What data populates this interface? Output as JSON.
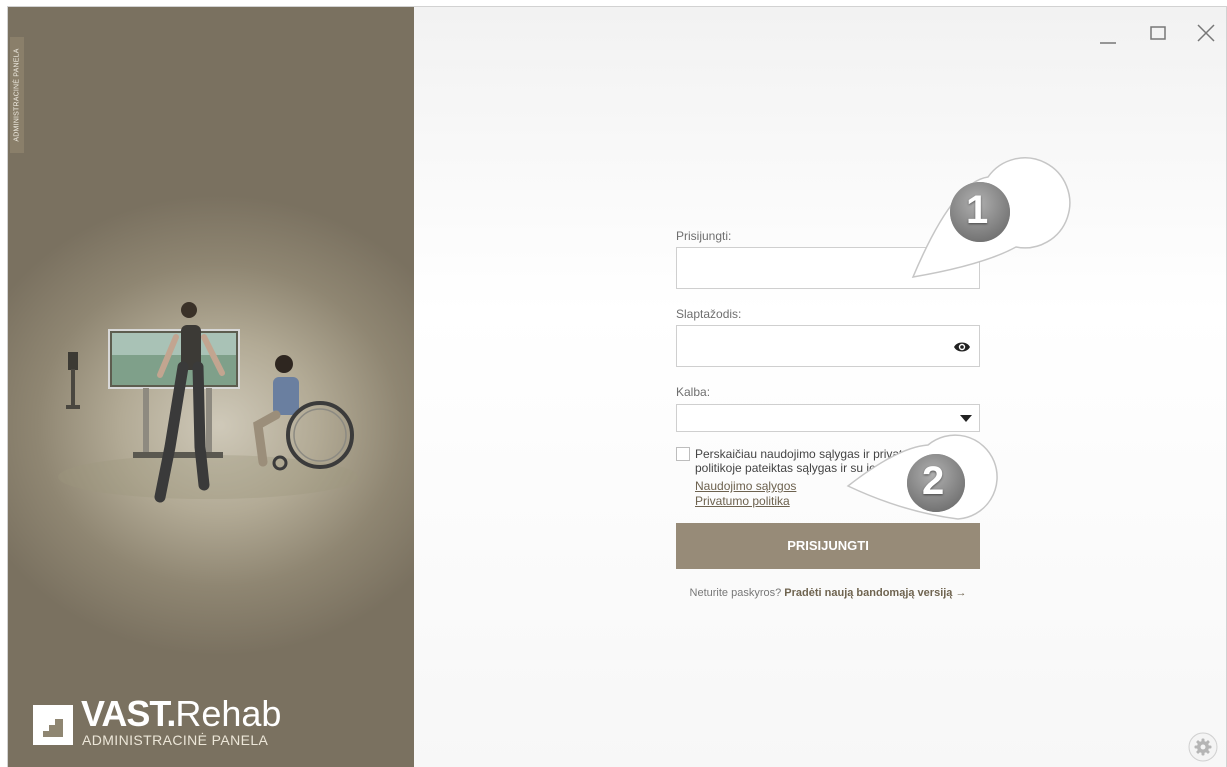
{
  "sidebar": {
    "vertical_tab": "ADMINISTRACINĖ PANELA",
    "brand_bold": "VAST.",
    "brand_light": "Rehab",
    "brand_subtitle": "ADMINISTRACINĖ PANELA"
  },
  "form": {
    "username_label": "Prisijungti:",
    "username_value": "",
    "password_label": "Slaptažodis:",
    "password_value": "",
    "language_label": "Kalba:",
    "language_value": "",
    "terms_text": "Perskaičiau naudojimo sąlygas ir privatumo politikoje pateiktas sąlygas ir su jomis sutinku.",
    "terms_link": "Naudojimo sąlygos",
    "privacy_link": "Privatumo politika",
    "login_button": "PRISIJUNGTI",
    "signup_question": "Neturite paskyros?",
    "signup_link": "Pradėti naują bandomąją versiją →"
  },
  "callouts": [
    "1",
    "2"
  ],
  "icons": [
    "minimize-icon",
    "maximize-icon",
    "close-icon",
    "eye-icon",
    "chevron-down-icon",
    "gear-icon"
  ],
  "colors": {
    "accent": "#978b78",
    "sidebar": "#8f8672"
  }
}
